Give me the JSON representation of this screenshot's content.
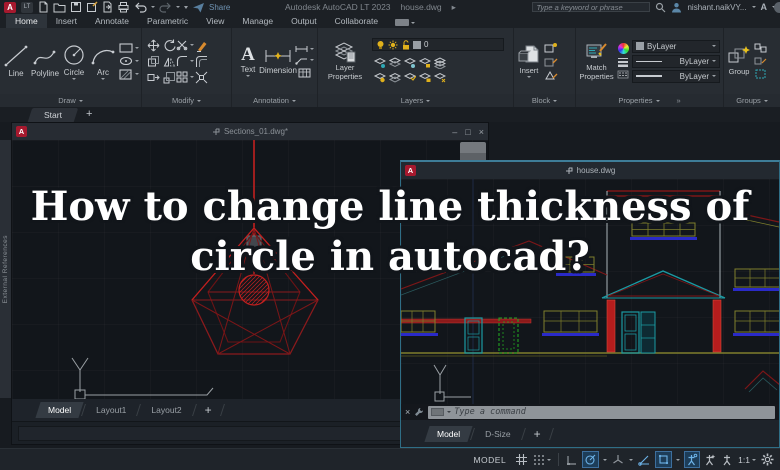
{
  "titlebar": {
    "logo_a": "A",
    "logo_lt": "LT",
    "share": "Share",
    "app_title": "Autodesk AutoCAD LT 2023",
    "doc_title": "house.dwg",
    "title_caret": "▸",
    "search_placeholder": "Type a keyword or phrase",
    "username": "nishant.naikVY...",
    "account_initial": "A"
  },
  "ribbon_tabs": [
    {
      "label": "Home",
      "active": true
    },
    {
      "label": "Insert"
    },
    {
      "label": "Annotate"
    },
    {
      "label": "Parametric"
    },
    {
      "label": "View"
    },
    {
      "label": "Manage"
    },
    {
      "label": "Output"
    },
    {
      "label": "Collaborate"
    }
  ],
  "panels": {
    "draw": {
      "label": "Draw",
      "tools": [
        {
          "label": "Line"
        },
        {
          "label": "Polyline"
        },
        {
          "label": "Circle"
        },
        {
          "label": "Arc"
        }
      ]
    },
    "modify": {
      "label": "Modify"
    },
    "annotation": {
      "label": "Annotation",
      "text_label": "Text",
      "dimension_label": "Dimension"
    },
    "layers": {
      "label": "Layers",
      "layer_props_line1": "Layer",
      "layer_props_line2": "Properties",
      "current_layer": "0"
    },
    "block": {
      "label": "Block",
      "insert_label": "Insert"
    },
    "properties": {
      "label": "Properties",
      "match_line1": "Match",
      "match_line2": "Properties",
      "color_value": "ByLayer",
      "lineweight_value": "ByLayer",
      "linetype_value": "ByLayer",
      "launcher": "»"
    },
    "groups": {
      "label": "Groups",
      "group_label": "Group"
    }
  },
  "file_tabs": {
    "start_label": "Start",
    "add_label": "+"
  },
  "window1": {
    "title": "Sections_01.dwg*",
    "minimize": "–",
    "maximize": "□",
    "close": "×",
    "tabs": [
      {
        "label": "Model",
        "active": true
      },
      {
        "label": "Layout1"
      },
      {
        "label": "Layout2"
      }
    ],
    "add_tab": "+"
  },
  "window2": {
    "title": "house.dwg",
    "command_close": "×",
    "command_placeholder": "Type a command",
    "tabs": [
      {
        "label": "Model",
        "active": true
      },
      {
        "label": "D-Size"
      }
    ],
    "add_tab": "+"
  },
  "side_palette": {
    "label": "External References"
  },
  "overlay": {
    "line1": "How to change line thickness of",
    "line2": "circle in autocad?"
  },
  "statusbar": {
    "model_label": "MODEL",
    "scale_label": "1:1"
  },
  "colors": {
    "brand_red": "#a6192e",
    "highlight_blue": "#3d6f9e",
    "canvas_bg": "#12161b",
    "wire_dark_red": "#7c1618",
    "wire_bright_red": "#c2201f",
    "wire_teal": "#1b9aa3",
    "wire_olive": "#7f7f2c",
    "wire_blue": "#2a2ac8",
    "wire_green": "#21a321",
    "accent_yellow": "#e0b11c"
  }
}
